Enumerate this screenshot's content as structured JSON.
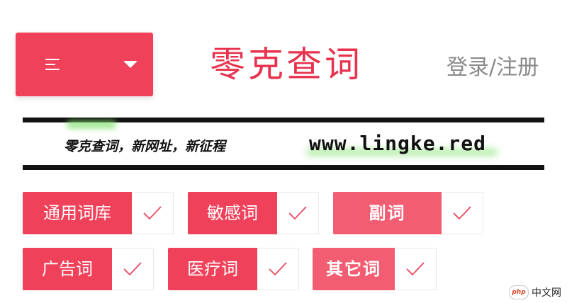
{
  "header": {
    "menu": {
      "icon": "hamburger-icon",
      "dropdown_icon": "caret-down-icon"
    },
    "logo_text": "零克查词",
    "login_label": "登录/注册"
  },
  "banner": {
    "slogan": "零克查词，新网址，新征程",
    "url": "www.lingke.red"
  },
  "categories": [
    {
      "label": "通用词库",
      "checked": true
    },
    {
      "label": "敏感词",
      "checked": true
    },
    {
      "label": "副词",
      "checked": true
    },
    {
      "label": "广告词",
      "checked": true
    },
    {
      "label": "医疗词",
      "checked": true
    },
    {
      "label": "其它词",
      "checked": true
    }
  ],
  "watermark": {
    "badge": "php",
    "text": "中文网"
  },
  "colors": {
    "accent": "#f0415a",
    "logo": "#e8334e",
    "muted": "#8a8a8a"
  }
}
